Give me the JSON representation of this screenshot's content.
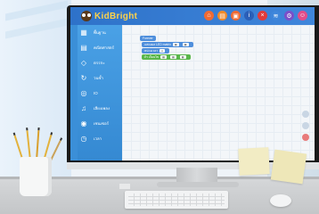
{
  "app": {
    "logo_text": "KidBright",
    "header_buttons": [
      {
        "icon": "home-icon",
        "color": "#f06a33"
      },
      {
        "icon": "folder-icon",
        "color": "#f08a2a"
      },
      {
        "icon": "save-icon",
        "color": "#f06a33"
      },
      {
        "icon": "info-icon",
        "color": "#2b5fb8"
      },
      {
        "icon": "close-icon",
        "color": "#e23b3b"
      },
      {
        "icon": "wifi-icon",
        "color": "#3f86db"
      },
      {
        "icon": "settings-icon",
        "color": "#7b4fc9"
      },
      {
        "icon": "user-icon",
        "color": "#e24d8a"
      }
    ]
  },
  "sidebar": {
    "items": [
      {
        "label": "พื้นฐาน",
        "icon": "grid-icon"
      },
      {
        "label": "คณิตศาสตร์",
        "icon": "calculator-icon"
      },
      {
        "label": "ตรรกะ",
        "icon": "logic-icon"
      },
      {
        "label": "วนซ้ำ",
        "icon": "loop-icon"
      },
      {
        "label": "IO",
        "icon": "io-icon"
      },
      {
        "label": "เสียงเพลง",
        "icon": "music-icon"
      },
      {
        "label": "เซนเซอร์",
        "icon": "sensor-icon"
      },
      {
        "label": "เวลา",
        "icon": "clock-icon"
      }
    ]
  },
  "workspace": {
    "blocks": [
      {
        "text": "Forever",
        "color": "blue"
      },
      {
        "text": "แสดงผล LED matrix",
        "color": "blue"
      },
      {
        "text": "หน่วงเวลา",
        "color": "blue"
      },
      {
        "text": "ถ้า เงื่อนไข",
        "color": "green"
      }
    ]
  },
  "colors": {
    "header": "#2e72c9",
    "sidebar": "#3f95dd",
    "block_blue": "#4f8fdc",
    "block_green": "#59b64a"
  }
}
